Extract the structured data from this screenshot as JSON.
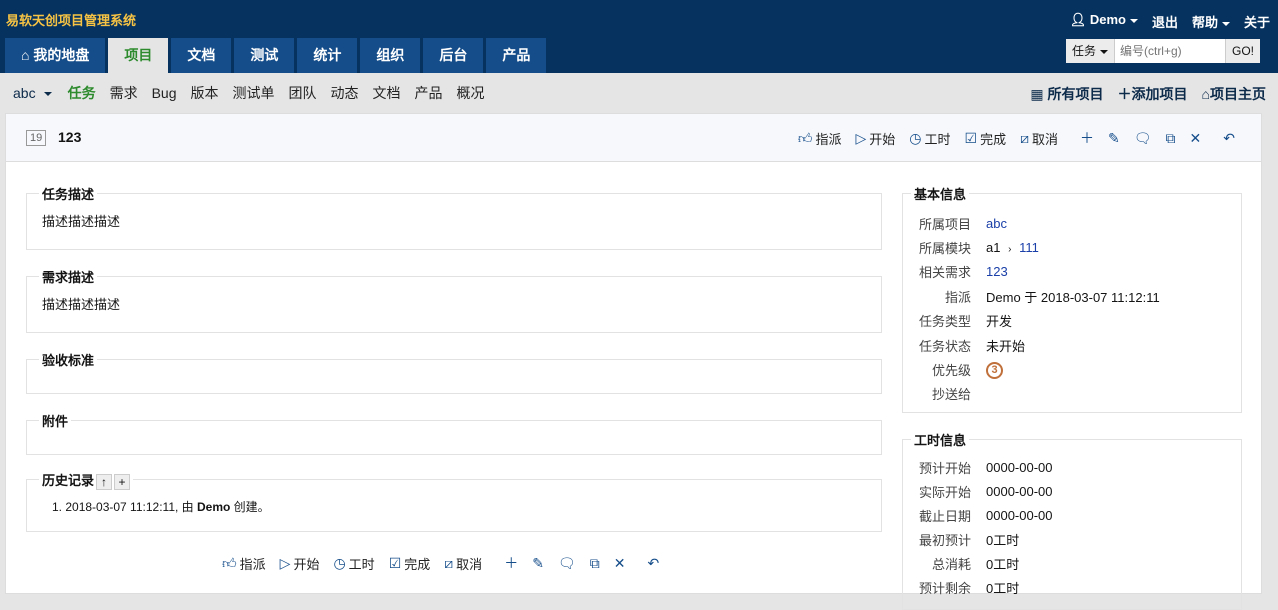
{
  "header": {
    "brand": "易软天创项目管理系统",
    "user": "Demo",
    "logout": "退出",
    "help": "帮助",
    "about": "关于",
    "tabs": [
      "我的地盘",
      "项目",
      "文档",
      "测试",
      "统计",
      "组织",
      "后台",
      "产品"
    ],
    "search": {
      "type": "任务",
      "placeholder": "编号(ctrl+g)",
      "go": "GO!"
    }
  },
  "subnav": {
    "project": "abc",
    "items": [
      "任务",
      "需求",
      "Bug",
      "版本",
      "测试单",
      "团队",
      "动态",
      "文档",
      "产品",
      "概况"
    ],
    "right": [
      "所有项目",
      "添加项目",
      "项目主页"
    ]
  },
  "task": {
    "id": "19",
    "title": "123"
  },
  "actions": {
    "assign": "指派",
    "start": "开始",
    "effort": "工时",
    "finish": "完成",
    "cancel": "取消"
  },
  "sections": {
    "desc_label": "任务描述",
    "desc": "描述描述描述",
    "story_label": "需求描述",
    "story": "描述描述描述",
    "verify_label": "验收标准",
    "files_label": "附件",
    "history_label": "历史记录",
    "history": {
      "prefix": "1. 2018-03-07 11:12:11, 由 ",
      "actor": "Demo",
      "suffix": " 创建。"
    }
  },
  "basic": {
    "title": "基本信息",
    "rows": [
      {
        "k": "所属项目",
        "v": "abc"
      },
      {
        "k": "所属模块",
        "v1": "a1",
        "v2": "111"
      },
      {
        "k": "相关需求",
        "v": "123"
      },
      {
        "k": "指派",
        "v": "Demo 于 2018-03-07 11:12:11"
      },
      {
        "k": "任务类型",
        "v": "开发"
      },
      {
        "k": "任务状态",
        "v": "未开始"
      },
      {
        "k": "优先级",
        "v": "3"
      },
      {
        "k": "抄送给",
        "v": ""
      }
    ]
  },
  "effort": {
    "title": "工时信息",
    "rows": [
      {
        "k": "预计开始",
        "v": "0000-00-00"
      },
      {
        "k": "实际开始",
        "v": "0000-00-00"
      },
      {
        "k": "截止日期",
        "v": "0000-00-00"
      },
      {
        "k": "最初预计",
        "v": "0工时"
      },
      {
        "k": "总消耗",
        "v": "0工时"
      },
      {
        "k": "预计剩余",
        "v": "0工时"
      }
    ]
  },
  "colors": {
    "header": "#06325f",
    "tab": "#154d8a",
    "active": "#2d8a2d",
    "brand": "#f6c344",
    "link": "#1a3fa8"
  }
}
